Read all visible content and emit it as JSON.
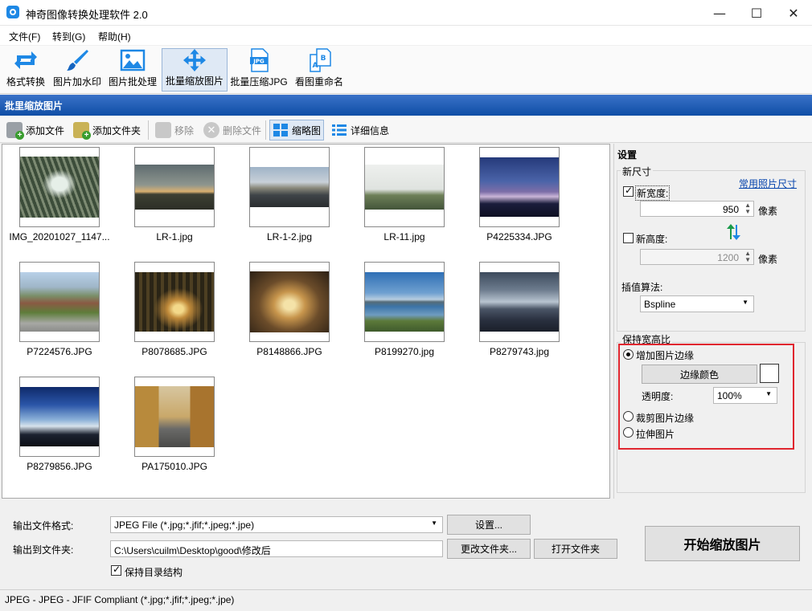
{
  "window": {
    "title": "神奇图像转换处理软件 2.0",
    "minimize": "—",
    "maximize": "☐",
    "close": "✕"
  },
  "menu": [
    "文件(F)",
    "转到(G)",
    "帮助(H)"
  ],
  "toolbar": [
    {
      "label": "格式转换",
      "icon": "refresh-arrows-icon"
    },
    {
      "label": "图片加水印",
      "icon": "paintbrush-icon"
    },
    {
      "label": "图片批处理",
      "icon": "picture-icon"
    },
    {
      "label": "批量缩放图片",
      "icon": "move-arrows-icon"
    },
    {
      "label": "批量压缩JPG",
      "icon": "jpg-file-icon"
    },
    {
      "label": "看图重命名",
      "icon": "rename-ab-icon"
    }
  ],
  "section_title": "批里缩放图片",
  "filebar": {
    "add_file": "添加文件",
    "add_folder": "添加文件夹",
    "remove": "移除",
    "delete_file": "删除文件",
    "thumbnail_view": "缩略图",
    "detail_view": "详细信息"
  },
  "thumbnails": [
    {
      "name": "IMG_20201027_1147..."
    },
    {
      "name": "LR-1.jpg"
    },
    {
      "name": "LR-1-2.jpg"
    },
    {
      "name": "LR-11.jpg"
    },
    {
      "name": "P4225334.JPG"
    },
    {
      "name": "P7224576.JPG"
    },
    {
      "name": "P8078685.JPG"
    },
    {
      "name": "P8148866.JPG"
    },
    {
      "name": "P8199270.jpg"
    },
    {
      "name": "P8279743.jpg"
    },
    {
      "name": "P8279856.JPG"
    },
    {
      "name": "PA175010.JPG"
    }
  ],
  "settings": {
    "title": "设置",
    "new_size": "新尺寸",
    "common_sizes_link": "常用照片尺寸",
    "new_width_label": "新宽度:",
    "new_width_value": "950",
    "new_width_checked": true,
    "unit": "像素",
    "new_height_label": "新高度:",
    "new_height_value": "1200",
    "new_height_checked": false,
    "interp_label": "插值算法:",
    "interp_value": "Bspline",
    "keep_ratio": "保持宽高比",
    "opt_add_border": "增加图片边缘",
    "border_color_btn": "边缘颜色",
    "opacity_label": "透明度:",
    "opacity_value": "100%",
    "opt_crop": "裁剪图片边缘",
    "opt_stretch": "拉伸图片",
    "selected_option": "add_border",
    "highlight_color": "#e0262f"
  },
  "output": {
    "format_label": "输出文件格式:",
    "format_value": "JPEG File (*.jpg;*.jfif;*.jpeg;*.jpe)",
    "settings_btn": "设置...",
    "folder_label": "输出到文件夹:",
    "folder_value": "C:\\Users\\cuilm\\Desktop\\good\\修改后",
    "change_folder_btn": "更改文件夹...",
    "open_folder_btn": "打开文件夹",
    "keep_structure": "保持目录结构",
    "keep_structure_checked": true,
    "start_btn": "开始缩放图片"
  },
  "status": "JPEG - JPEG - JFIF Compliant (*.jpg;*.jfif;*.jpeg;*.jpe)"
}
